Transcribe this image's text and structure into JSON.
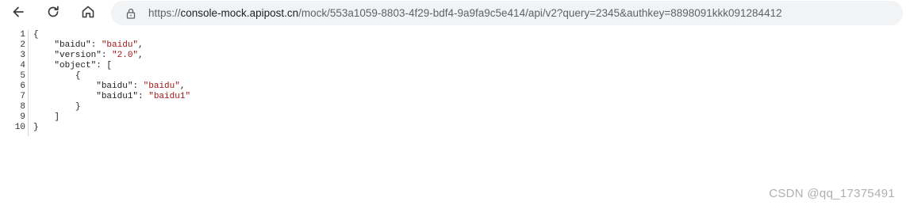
{
  "browser": {
    "url_prefix": "https://",
    "url_host": "console-mock.apipost.cn",
    "url_path": "/mock/553a1059-8803-4f29-bdf4-9a9fa9c5e414/api/v2?query=2345&authkey=8898091kkk091284412",
    "icons": {
      "back": "arrow-left-icon",
      "reload": "reload-icon",
      "home": "home-icon",
      "lock": "lock-icon"
    }
  },
  "json_view": {
    "line_numbers": [
      "1",
      "2",
      "3",
      "4",
      "5",
      "6",
      "7",
      "8",
      "9",
      "10"
    ],
    "lines": [
      {
        "indent": "",
        "parts": [
          {
            "t": "{",
            "c": "p"
          }
        ]
      },
      {
        "indent": "    ",
        "parts": [
          {
            "t": "\"baidu\"",
            "c": "k"
          },
          {
            "t": ": ",
            "c": "p"
          },
          {
            "t": "\"baidu\"",
            "c": "s"
          },
          {
            "t": ",",
            "c": "p"
          }
        ]
      },
      {
        "indent": "    ",
        "parts": [
          {
            "t": "\"version\"",
            "c": "k"
          },
          {
            "t": ": ",
            "c": "p"
          },
          {
            "t": "\"2.0\"",
            "c": "s"
          },
          {
            "t": ",",
            "c": "p"
          }
        ]
      },
      {
        "indent": "    ",
        "parts": [
          {
            "t": "\"object\"",
            "c": "k"
          },
          {
            "t": ": [",
            "c": "p"
          }
        ]
      },
      {
        "indent": "        ",
        "parts": [
          {
            "t": "{",
            "c": "p"
          }
        ]
      },
      {
        "indent": "            ",
        "parts": [
          {
            "t": "\"baidu\"",
            "c": "k"
          },
          {
            "t": ": ",
            "c": "p"
          },
          {
            "t": "\"baidu\"",
            "c": "s"
          },
          {
            "t": ",",
            "c": "p"
          }
        ]
      },
      {
        "indent": "            ",
        "parts": [
          {
            "t": "\"baidu1\"",
            "c": "k"
          },
          {
            "t": ": ",
            "c": "p"
          },
          {
            "t": "\"baidu1\"",
            "c": "s"
          }
        ]
      },
      {
        "indent": "        ",
        "parts": [
          {
            "t": "}",
            "c": "p"
          }
        ]
      },
      {
        "indent": "    ",
        "parts": [
          {
            "t": "]",
            "c": "p"
          }
        ]
      },
      {
        "indent": "",
        "parts": [
          {
            "t": "}",
            "c": "p"
          }
        ]
      }
    ],
    "colors": {
      "string": "#a31515",
      "key": "#202020",
      "line_number": "#333333"
    }
  },
  "watermark": "CSDN @qq_17375491"
}
